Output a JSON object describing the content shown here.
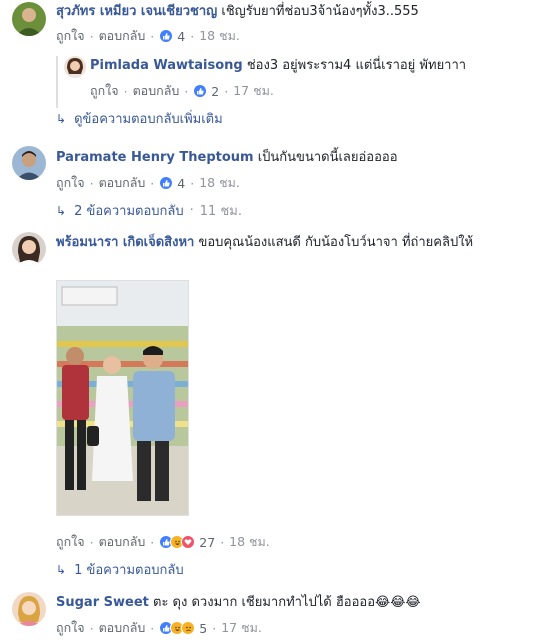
{
  "comments": [
    {
      "author": "สุวภัทร เหมียว เจนเชียวชาญ",
      "text": "เชิญรับยาที่ช่อบ3จ้าน้องๆทั้ง3..555",
      "like": "ถูกใจ",
      "reply": "ตอบกลับ",
      "reactions": "4",
      "time": "18 ชม."
    },
    {
      "author": "Pimlada Wawtaisong",
      "text": "ช่อง3 อยู่พระราม4 แต่นี่เราอยู่ พัทยาาา",
      "like": "ถูกใจ",
      "reply": "ตอบกลับ",
      "reactions": "2",
      "time": "17 ชม."
    },
    {
      "author": "Paramate Henry Theptoum",
      "text": "เป็นกันขนาดนี้เลยอ่ออออ",
      "like": "ถูกใจ",
      "reply": "ตอบกลับ",
      "reactions": "4",
      "time": "18 ชม."
    },
    {
      "author": "พร้อมนารา เกิดเจ็ดสิงหา",
      "text": "ขอบคุณน้องแสนดี กับน้องโบว์นาจา ที่ถ่ายคลิปให้",
      "like": "ถูกใจ",
      "reply": "ตอบกลับ",
      "reactions": "27",
      "time": "18 ชม."
    },
    {
      "author": "Sugar Sweet",
      "text": "ตะ ดุง ดวงมาก เชียมากทำไปได้ ฮืออออ😂😂😂",
      "like": "ถูกใจ",
      "reply": "ตอบกลับ",
      "reactions": "5",
      "time": "17 ชม."
    }
  ],
  "more_replies": [
    {
      "label": "ดูข้อความตอบกลับเพิ่มเติม",
      "time": ""
    },
    {
      "label": "2 ข้อความตอบกลับ",
      "time": "11 ชม."
    },
    {
      "label": "1 ข้อความตอบกลับ",
      "time": ""
    }
  ],
  "colors": {
    "author": "#385898",
    "text": "#1d2129",
    "meta": "#606770",
    "like": "#4080ff",
    "haha": "#f7b125",
    "love": "#f25268"
  }
}
